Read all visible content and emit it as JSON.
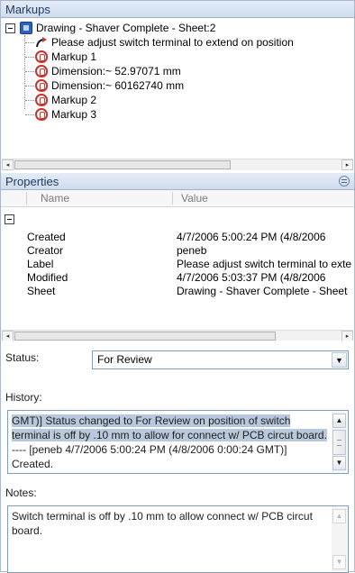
{
  "markups_panel": {
    "title": "Markups",
    "root": "Drawing - Shaver Complete - Sheet:2",
    "items": [
      {
        "icon": "note-arrow-icon",
        "label": "Please adjust switch terminal to extend on position"
      },
      {
        "icon": "markup-icon",
        "label": "Markup 1"
      },
      {
        "icon": "markup-icon",
        "label": "Dimension:~ 52.97071 mm"
      },
      {
        "icon": "markup-icon",
        "label": "Dimension:~ 60162740 mm"
      },
      {
        "icon": "markup-icon",
        "label": "Markup 2"
      },
      {
        "icon": "markup-icon",
        "label": "Markup 3"
      }
    ]
  },
  "properties_panel": {
    "title": "Properties",
    "columns": [
      "Name",
      "Value"
    ],
    "rows": [
      {
        "name": "Created",
        "value": "4/7/2006  5:00:24 PM  (4/8/2006"
      },
      {
        "name": "Creator",
        "value": "peneb"
      },
      {
        "name": "Label",
        "value": "Please adjust switch terminal to extend"
      },
      {
        "name": "Modified",
        "value": "4/7/2006  5:03:37 PM  (4/8/2006"
      },
      {
        "name": "Sheet",
        "value": "Drawing - Shaver Complete - Sheet"
      }
    ]
  },
  "status": {
    "label": "Status:",
    "value": "For Review"
  },
  "history": {
    "label": "History:",
    "text_highlighted": "GMT)] Status changed to For Review on position of switch terminal is off by .10 mm to allow for connect w/ PCB circut board.",
    "text_plain": " ---- [peneb 4/7/2006  5:00:24 PM  (4/8/2006  0:00:24 GMT)] Created."
  },
  "notes": {
    "label": "Notes:",
    "text": "Switch terminal is off by .10 mm to allow connect w/ PCB circut board."
  },
  "colors": {
    "header_text": "#1f3b63",
    "selection": "#b9c9dd",
    "border": "#7f9db9"
  }
}
